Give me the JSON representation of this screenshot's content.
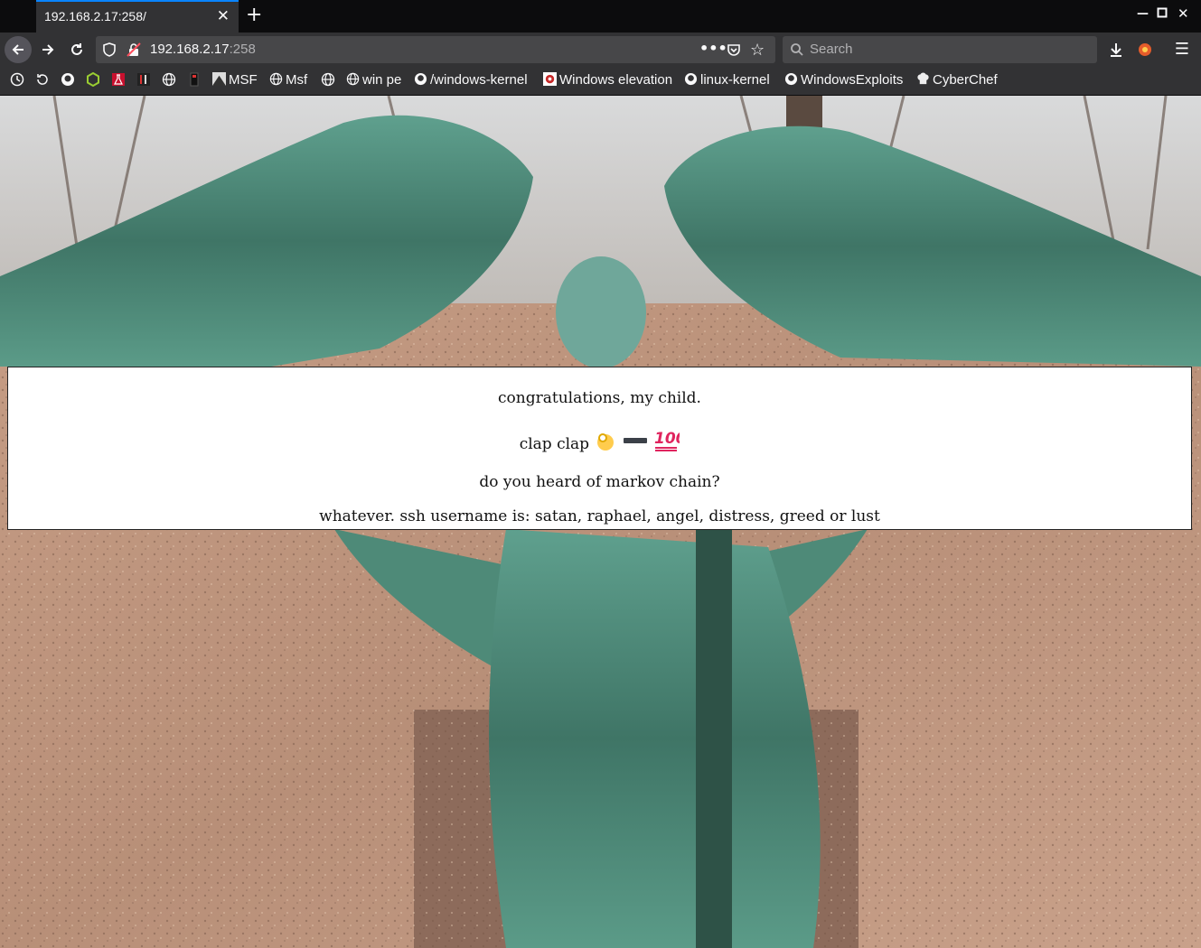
{
  "browser": {
    "tab": {
      "title": "192.168.2.17:258/"
    },
    "url": {
      "host": "192.168.2.17",
      "port": ":258"
    },
    "search": {
      "placeholder": "Search"
    },
    "bookmarks": [
      {
        "label": "MSF",
        "icon": "image-icon"
      },
      {
        "label": "Msf",
        "icon": "globe-icon"
      },
      {
        "label": "win pe",
        "icon": "globe-icon"
      },
      {
        "label": "/windows-kernel",
        "icon": "github-icon"
      },
      {
        "label": "Windows elevation",
        "icon": "site-icon"
      },
      {
        "label": "linux-kernel",
        "icon": "github-icon"
      },
      {
        "label": "WindowsExploits",
        "icon": "github-icon"
      },
      {
        "label": "CyberChef",
        "icon": "chef-hat-icon"
      }
    ]
  },
  "page": {
    "line1": "congratulations, my child.",
    "line2": "clap clap",
    "line3": "do you heard of markov chain?",
    "line4": "whatever. ssh username is: satan, raphael, angel, distress, greed or lust"
  }
}
